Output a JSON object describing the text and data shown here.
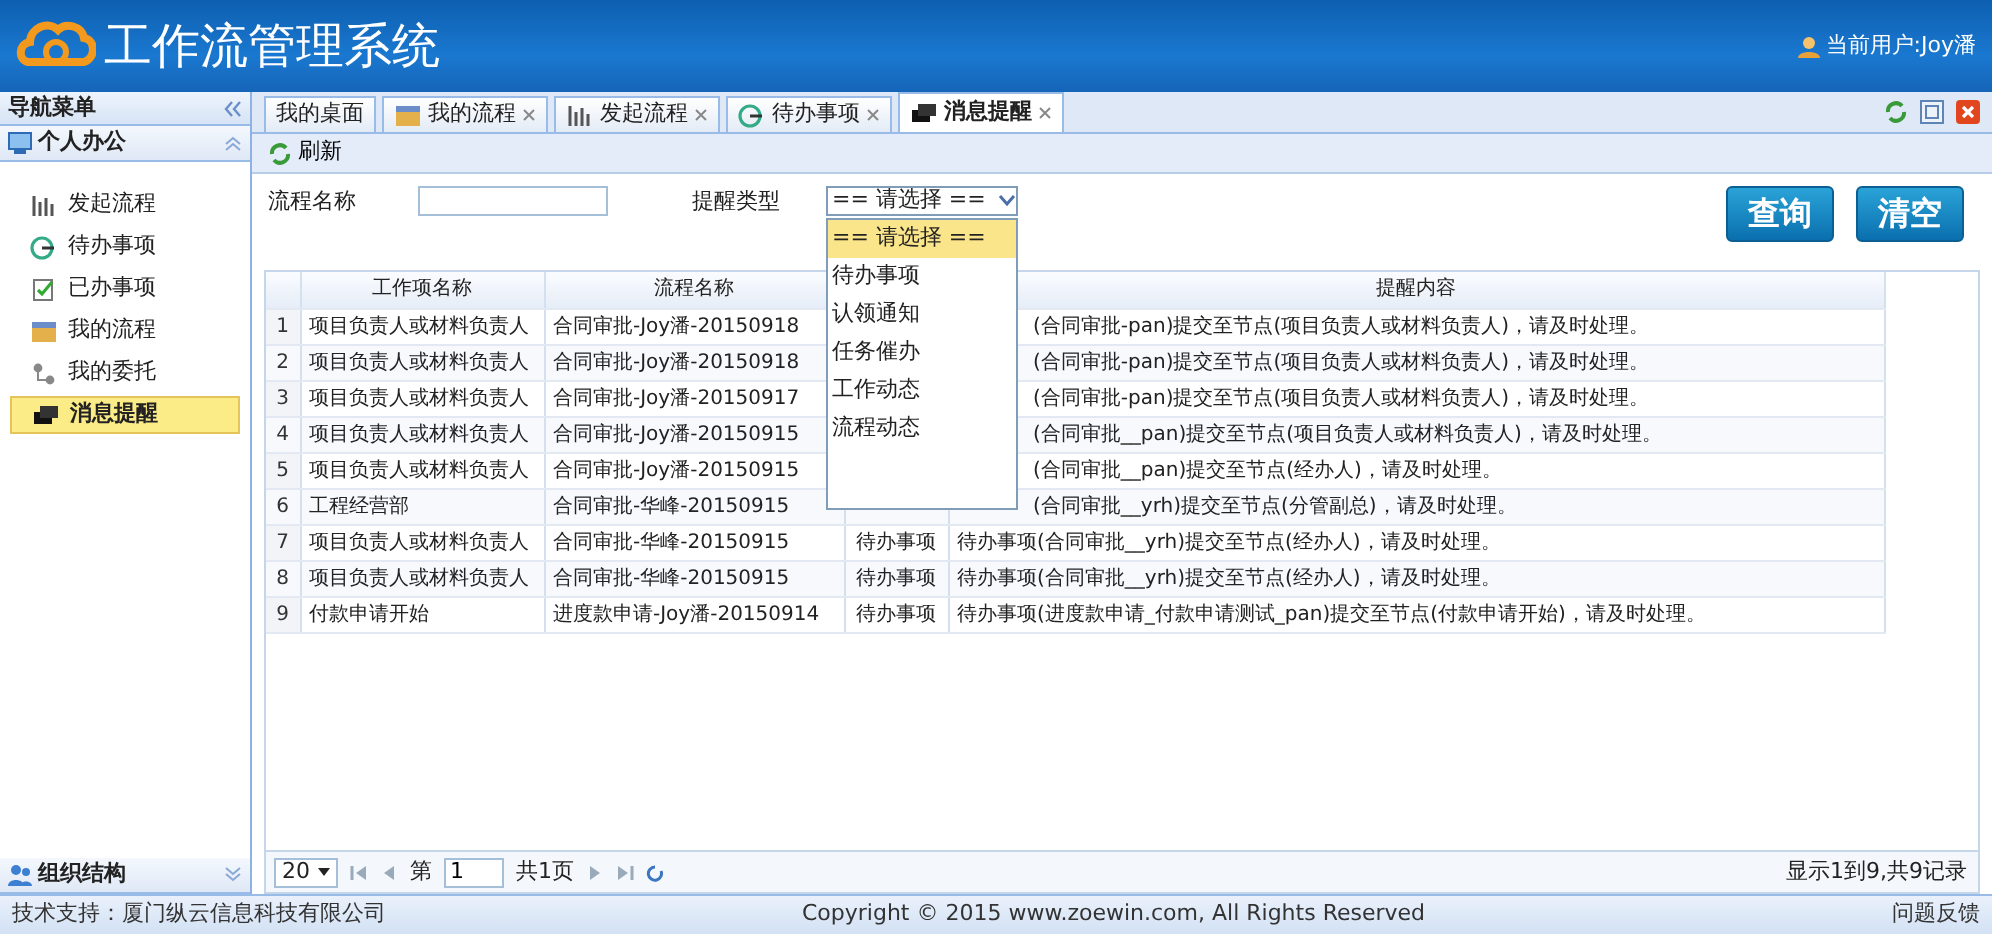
{
  "header": {
    "title": "工作流管理系统",
    "user": "当前用户:Joy潘"
  },
  "sidebar": {
    "title": "导航菜单",
    "sections": [
      {
        "label": "个人办公",
        "expanded": true,
        "items": [
          {
            "label": "发起流程",
            "selected": false
          },
          {
            "label": "待办事项",
            "selected": false
          },
          {
            "label": "已办事项",
            "selected": false
          },
          {
            "label": "我的流程",
            "selected": false
          },
          {
            "label": "我的委托",
            "selected": false
          },
          {
            "label": "消息提醒",
            "selected": true
          }
        ]
      },
      {
        "label": "组织结构",
        "expanded": false
      }
    ]
  },
  "tabs": [
    {
      "label": "我的桌面",
      "closable": false,
      "selected": false
    },
    {
      "label": "我的流程",
      "closable": true,
      "selected": false
    },
    {
      "label": "发起流程",
      "closable": true,
      "selected": false
    },
    {
      "label": "待办事项",
      "closable": true,
      "selected": false
    },
    {
      "label": "消息提醒",
      "closable": true,
      "selected": true
    }
  ],
  "toolbar": {
    "refresh": "刷新"
  },
  "filters": {
    "name_label": "流程名称",
    "type_label": "提醒类型",
    "type_value": "== 请选择 ==",
    "dropdown_open": true,
    "options": [
      {
        "label": "== 请选择 ==",
        "selected": true
      },
      {
        "label": "待办事项",
        "selected": false
      },
      {
        "label": "认领通知",
        "selected": false
      },
      {
        "label": "任务催办",
        "selected": false
      },
      {
        "label": "工作动态",
        "selected": false
      },
      {
        "label": "流程动态",
        "selected": false
      }
    ]
  },
  "buttons": [
    "查询",
    "清空"
  ],
  "table": {
    "columns": [
      "工作项名称",
      "流程名称",
      "提醒内容"
    ],
    "rows": [
      {
        "index": "1",
        "work_item": "项目负责人或材料负责人",
        "flow": "合同审批-Joy潘-20150918",
        "content": "(合同审批-pan)提交至节点(项目负责人或材料负责人)，请及时处理。",
        "covered": true
      },
      {
        "index": "2",
        "work_item": "项目负责人或材料负责人",
        "flow": "合同审批-Joy潘-20150918",
        "content": "(合同审批-pan)提交至节点(项目负责人或材料负责人)，请及时处理。",
        "covered": true
      },
      {
        "index": "3",
        "work_item": "项目负责人或材料负责人",
        "flow": "合同审批-Joy潘-20150917",
        "content": "(合同审批-pan)提交至节点(项目负责人或材料负责人)，请及时处理。",
        "covered": true
      },
      {
        "index": "4",
        "work_item": "项目负责人或材料负责人",
        "flow": "合同审批-Joy潘-20150915",
        "content": "(合同审批__pan)提交至节点(项目负责人或材料负责人)，请及时处理。",
        "covered": true
      },
      {
        "index": "5",
        "work_item": "项目负责人或材料负责人",
        "flow": "合同审批-Joy潘-20150915",
        "content": "(合同审批__pan)提交至节点(经办人)，请及时处理。",
        "covered": true
      },
      {
        "index": "6",
        "work_item": "工程经营部",
        "flow": "合同审批-华峰-20150915",
        "content": "(合同审批__yrh)提交至节点(分管副总)，请及时处理。",
        "covered": true
      },
      {
        "index": "7",
        "work_item": "项目负责人或材料负责人",
        "flow": "合同审批-华峰-20150915",
        "type": "待办事项",
        "content": "待办事项(合同审批__yrh)提交至节点(经办人)，请及时处理。",
        "covered": false
      },
      {
        "index": "8",
        "work_item": "项目负责人或材料负责人",
        "flow": "合同审批-华峰-20150915",
        "type": "待办事项",
        "content": "待办事项(合同审批__yrh)提交至节点(经办人)，请及时处理。",
        "covered": false
      },
      {
        "index": "9",
        "work_item": "付款申请开始",
        "flow": "进度款申请-Joy潘-20150914",
        "type": "待办事项",
        "content": "待办事项(进度款申请_付款申请测试_pan)提交至节点(付款申请开始)，请及时处理。",
        "covered": false
      }
    ]
  },
  "pager": {
    "page_size": "20",
    "page_label": "第",
    "page": "1",
    "total_pages": "共1页",
    "summary": "显示1到9,共9记录"
  },
  "footer": {
    "support": "技术支持：厦门纵云信息科技有限公司",
    "copyright": "Copyright © 2015 www.zoewin.com, All Rights Reserved",
    "feedback": "问题反馈"
  }
}
